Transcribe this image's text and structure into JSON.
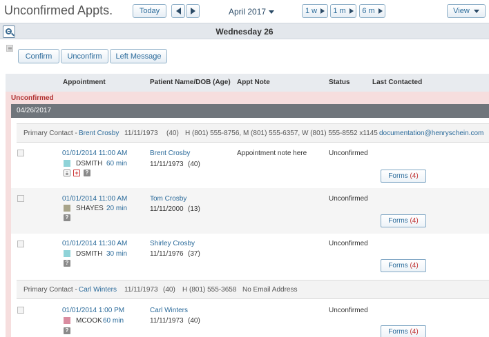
{
  "header": {
    "title": "Unconfirmed Appts.",
    "today_label": "Today",
    "month_label": "April 2017",
    "range_buttons": [
      "1 w",
      "1 m",
      "6 m"
    ],
    "view_label": "View"
  },
  "day_header": {
    "title": "Wednesday 26"
  },
  "actions": {
    "confirm": "Confirm",
    "unconfirm": "Unconfirm",
    "left_message": "Left Message"
  },
  "columns": [
    "Appointment",
    "Patient Name/DOB (Age)",
    "Appt Note",
    "Status",
    "Last Contacted"
  ],
  "group": {
    "label": "Unconfirmed",
    "date": "04/26/2017"
  },
  "contacts": [
    {
      "prefix": "Primary Contact -",
      "name": "Brent Crosby",
      "dob": "11/11/1973",
      "age": "(40)",
      "phones": "H (801) 555-8756, M (801) 555-6357, W (801) 555-8552 x1145",
      "email": "documentation@henryschein.com"
    },
    {
      "prefix": "Primary Contact -",
      "name": "Carl Winters",
      "dob": "11/11/1973",
      "age": "(40)",
      "phones": "H (801) 555-3658",
      "email": "No Email Address"
    }
  ],
  "appointments": [
    {
      "datetime": "01/01/2014 11:00 AM",
      "provider": "DSMITH",
      "duration": "60 min",
      "swatch": "#8fd3d8",
      "patient": "Brent Crosby",
      "dob": "11/11/1973",
      "age": "(40)",
      "note": "Appointment note here",
      "status": "Unconfirmed",
      "forms_label": "Forms",
      "forms_count": "(4)"
    },
    {
      "datetime": "01/01/2014 11:00 AM",
      "provider": "SHAYES",
      "duration": "20 min",
      "swatch": "#a8a48a",
      "patient": "Tom Crosby",
      "dob": "11/11/2000",
      "age": "(13)",
      "note": "",
      "status": "Unconfirmed",
      "forms_label": "Forms",
      "forms_count": "(4)"
    },
    {
      "datetime": "01/01/2014 11:30 AM",
      "provider": "DSMITH",
      "duration": "30 min",
      "swatch": "#8fd3d8",
      "patient": "Shirley Crosby",
      "dob": "11/11/1976",
      "age": "(37)",
      "note": "",
      "status": "Unconfirmed",
      "forms_label": "Forms",
      "forms_count": "(4)"
    },
    {
      "datetime": "01/01/2014 1:00 PM",
      "provider": "MCOOK",
      "duration": "60 min",
      "swatch": "#d98ca0",
      "patient": "Carl Winters",
      "dob": "11/11/1973",
      "age": "(40)",
      "note": "",
      "status": "Unconfirmed",
      "forms_label": "Forms",
      "forms_count": "(4)"
    }
  ]
}
